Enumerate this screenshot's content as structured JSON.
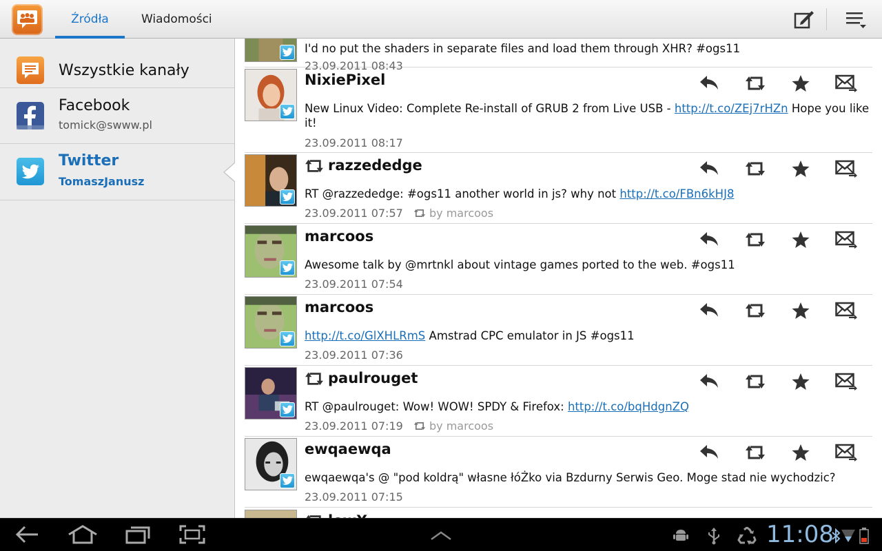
{
  "actionbar": {
    "app_icon": "tweetdeck-app-icon",
    "tabs": [
      {
        "label": "Źródła",
        "active": true
      },
      {
        "label": "Wiadomości",
        "active": false
      }
    ],
    "compose_icon": "compose-icon",
    "menu_icon": "overflow-menu-icon",
    "accent_color": "#1a76c8"
  },
  "sidebar": {
    "items": [
      {
        "title": "Wszystkie kanały",
        "icon": "all-channels-icon"
      },
      {
        "title": "Facebook",
        "subtitle": "tomick@swww.pl",
        "icon": "facebook-icon"
      },
      {
        "title": "Twitter",
        "subtitle": "TomaszJanusz",
        "icon": "twitter-icon",
        "selected": true
      }
    ]
  },
  "feed": {
    "partial_top": {
      "text": "I'd no put the shaders in separate files and load them through XHR? #ogs11",
      "time": "23.09.2011 08:43"
    },
    "tweets": [
      {
        "user": "NixiePixel",
        "retweet": false,
        "text_before": "New Linux Video: Complete Re-install of GRUB 2 from Live USB - ",
        "link": "http://t.co/ZEj7rHZn",
        "text_after": " Hope you like it!",
        "time": "23.09.2011 08:17"
      },
      {
        "user": "razzededge",
        "retweet": true,
        "text_before": "RT @razzededge: #ogs11 another world in js? why not ",
        "link": "http://t.co/FBn6kHJ8",
        "text_after": "",
        "time": "23.09.2011 07:57",
        "by": "by marcoos"
      },
      {
        "user": "marcoos",
        "retweet": false,
        "text_before": "Awesome talk by @mrtnkl about vintage games ported to the web. #ogs11",
        "link": "",
        "text_after": "",
        "time": "23.09.2011 07:54"
      },
      {
        "user": "marcoos",
        "retweet": false,
        "text_before": "",
        "link": "http://t.co/GlXHLRmS",
        "text_after": " Amstrad CPC emulator in JS #ogs11",
        "time": "23.09.2011 07:36"
      },
      {
        "user": "paulrouget",
        "retweet": true,
        "text_before": "RT @paulrouget: Wow! WOW! SPDY & Firefox: ",
        "link": "http://t.co/bqHdgnZQ",
        "text_after": "",
        "time": "23.09.2011 07:19",
        "by": "by marcoos"
      },
      {
        "user": "ewqaewqa",
        "retweet": false,
        "text_before": "ewqaewqa's @ \"pod koldrą\" własne łóŻko via Bzdurny Serwis Geo. Moge stad nie wychodzic?",
        "link": "",
        "text_after": "",
        "time": "23.09.2011 07:15"
      }
    ],
    "partial_bottom": {
      "user": "lowX..."
    },
    "actions": [
      "reply-icon",
      "retweet-icon",
      "favorite-icon",
      "direct-message-icon"
    ]
  },
  "systembar": {
    "clock": "11:08",
    "nav_icons": [
      "back-icon",
      "home-icon",
      "recent-apps-icon",
      "screenshot-icon",
      "expand-up-icon"
    ],
    "status_icons": [
      "android-debug-icon",
      "usb-icon",
      "recycle-icon",
      "bluetooth-icon",
      "wifi-icon",
      "battery-icon"
    ],
    "clock_color": "#8fbbe0"
  }
}
